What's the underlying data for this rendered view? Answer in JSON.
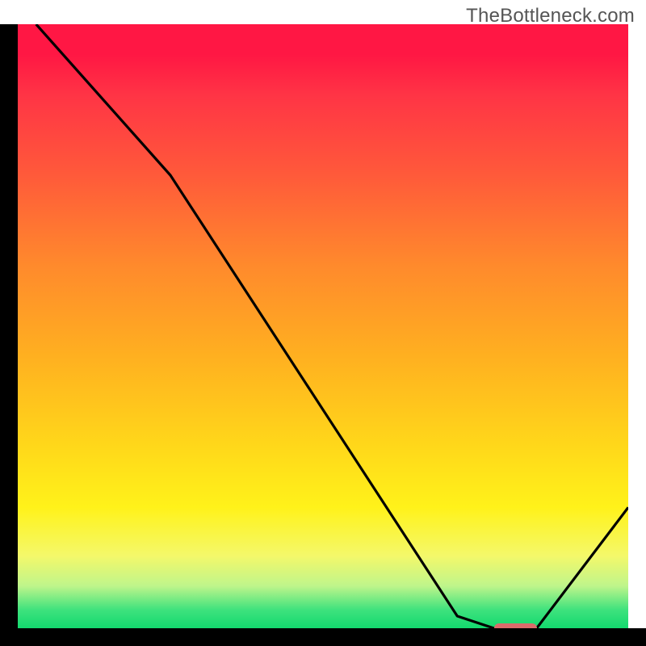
{
  "watermark": "TheBottleneck.com",
  "colors": {
    "gradient_top": "#FF1744",
    "gradient_mid1": "#FF8A2C",
    "gradient_mid2": "#FFD81A",
    "gradient_bottom": "#13D96E",
    "curve": "#000000",
    "marker": "#DB6B6B",
    "frame": "#000000"
  },
  "chart_data": {
    "type": "line",
    "title": "",
    "xlabel": "",
    "ylabel": "",
    "xlim": [
      0,
      100
    ],
    "ylim": [
      0,
      100
    ],
    "x": [
      3,
      25,
      72,
      78,
      85,
      100
    ],
    "values": [
      100,
      75,
      2,
      0,
      0,
      20
    ],
    "marker": {
      "x_start": 78,
      "x_end": 85,
      "y": 0
    },
    "notes": "Chart has no visible axis ticks or labels; values are normalized 0-100 from the plot area. Curve descends from top-left, kinks around x≈25, reaches y≈0 near x≈78–85 (where the red marker sits), then rises toward x=100."
  }
}
